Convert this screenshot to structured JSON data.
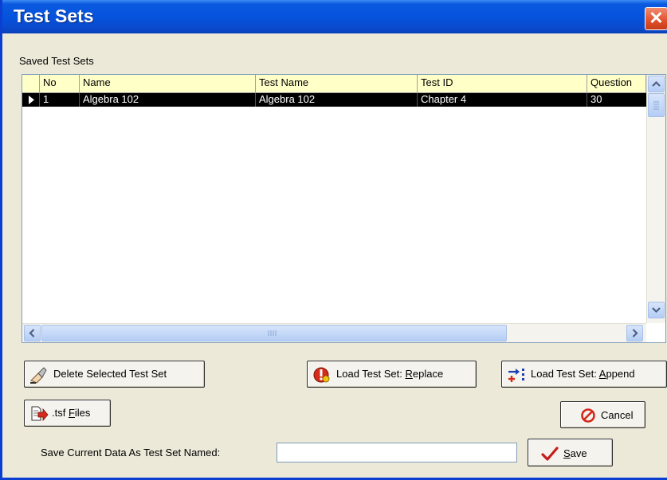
{
  "window": {
    "title": "Test Sets",
    "close_glyph": "✕"
  },
  "section_label": "Saved Test Sets",
  "table": {
    "columns": [
      "No",
      "Name",
      "Test Name",
      "Test ID",
      "Question"
    ],
    "rows": [
      {
        "No": "1",
        "Name": "Algebra 102",
        "Test Name": "Algebra  102",
        "Test ID": "Chapter 4",
        "Question": "30"
      }
    ],
    "selected_row": 0
  },
  "buttons": {
    "delete": {
      "label": "Delete Selected Test Set",
      "icon": "eraser-icon"
    },
    "load_replace": {
      "prefix": "Load Test Set: ",
      "accel": "R",
      "rest": "eplace",
      "icon": "warning-clock-icon"
    },
    "load_append": {
      "prefix": "Load Test Set: ",
      "accel": "A",
      "rest": "ppend",
      "icon": "append-arrows-icon"
    },
    "tsf_files": {
      "prefix": ".tsf ",
      "accel": "F",
      "rest": "iles",
      "icon": "export-file-icon"
    },
    "cancel": {
      "label": "Cancel",
      "icon": "no-entry-icon"
    },
    "save": {
      "accel": "S",
      "rest": "ave",
      "icon": "checkmark-icon"
    }
  },
  "save_prompt": {
    "label": "Save Current Data As Test Set Named:",
    "value": ""
  },
  "colors": {
    "title_bar": "#0552dc",
    "grid_header": "#ffffc8",
    "selected_row": "#000000",
    "close_button": "#e0502b",
    "cancel_icon": "#d6281c",
    "save_check": "#c81c1c"
  }
}
